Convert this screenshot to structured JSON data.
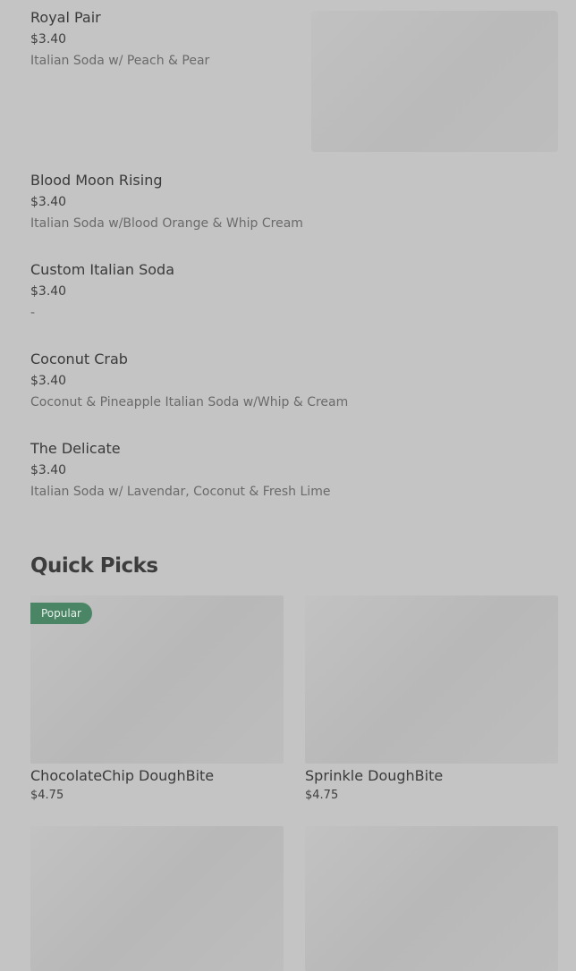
{
  "menu_items": [
    {
      "name": "Royal Pair",
      "price": "$3.40",
      "description": "Italian Soda w/ Peach & Pear"
    },
    {
      "name": "Blood Moon Rising",
      "price": "$3.40",
      "description": "Italian Soda w/Blood Orange & Whip Cream"
    },
    {
      "name": "Custom Italian Soda",
      "price": "$3.40",
      "description": "-"
    },
    {
      "name": "Coconut Crab",
      "price": "$3.40",
      "description": "Coconut & Pineapple Italian Soda w/Whip & Cream"
    },
    {
      "name": "The Delicate",
      "price": "$3.40",
      "description": "Italian Soda w/ Lavendar, Coconut & Fresh Lime"
    }
  ],
  "quick_picks": {
    "title": "Quick Picks",
    "cards": [
      {
        "name": "ChocolateChip DoughBite",
        "price": "$4.75",
        "badge": "Popular"
      },
      {
        "name": "Sprinkle DoughBite",
        "price": "$4.75"
      }
    ]
  }
}
